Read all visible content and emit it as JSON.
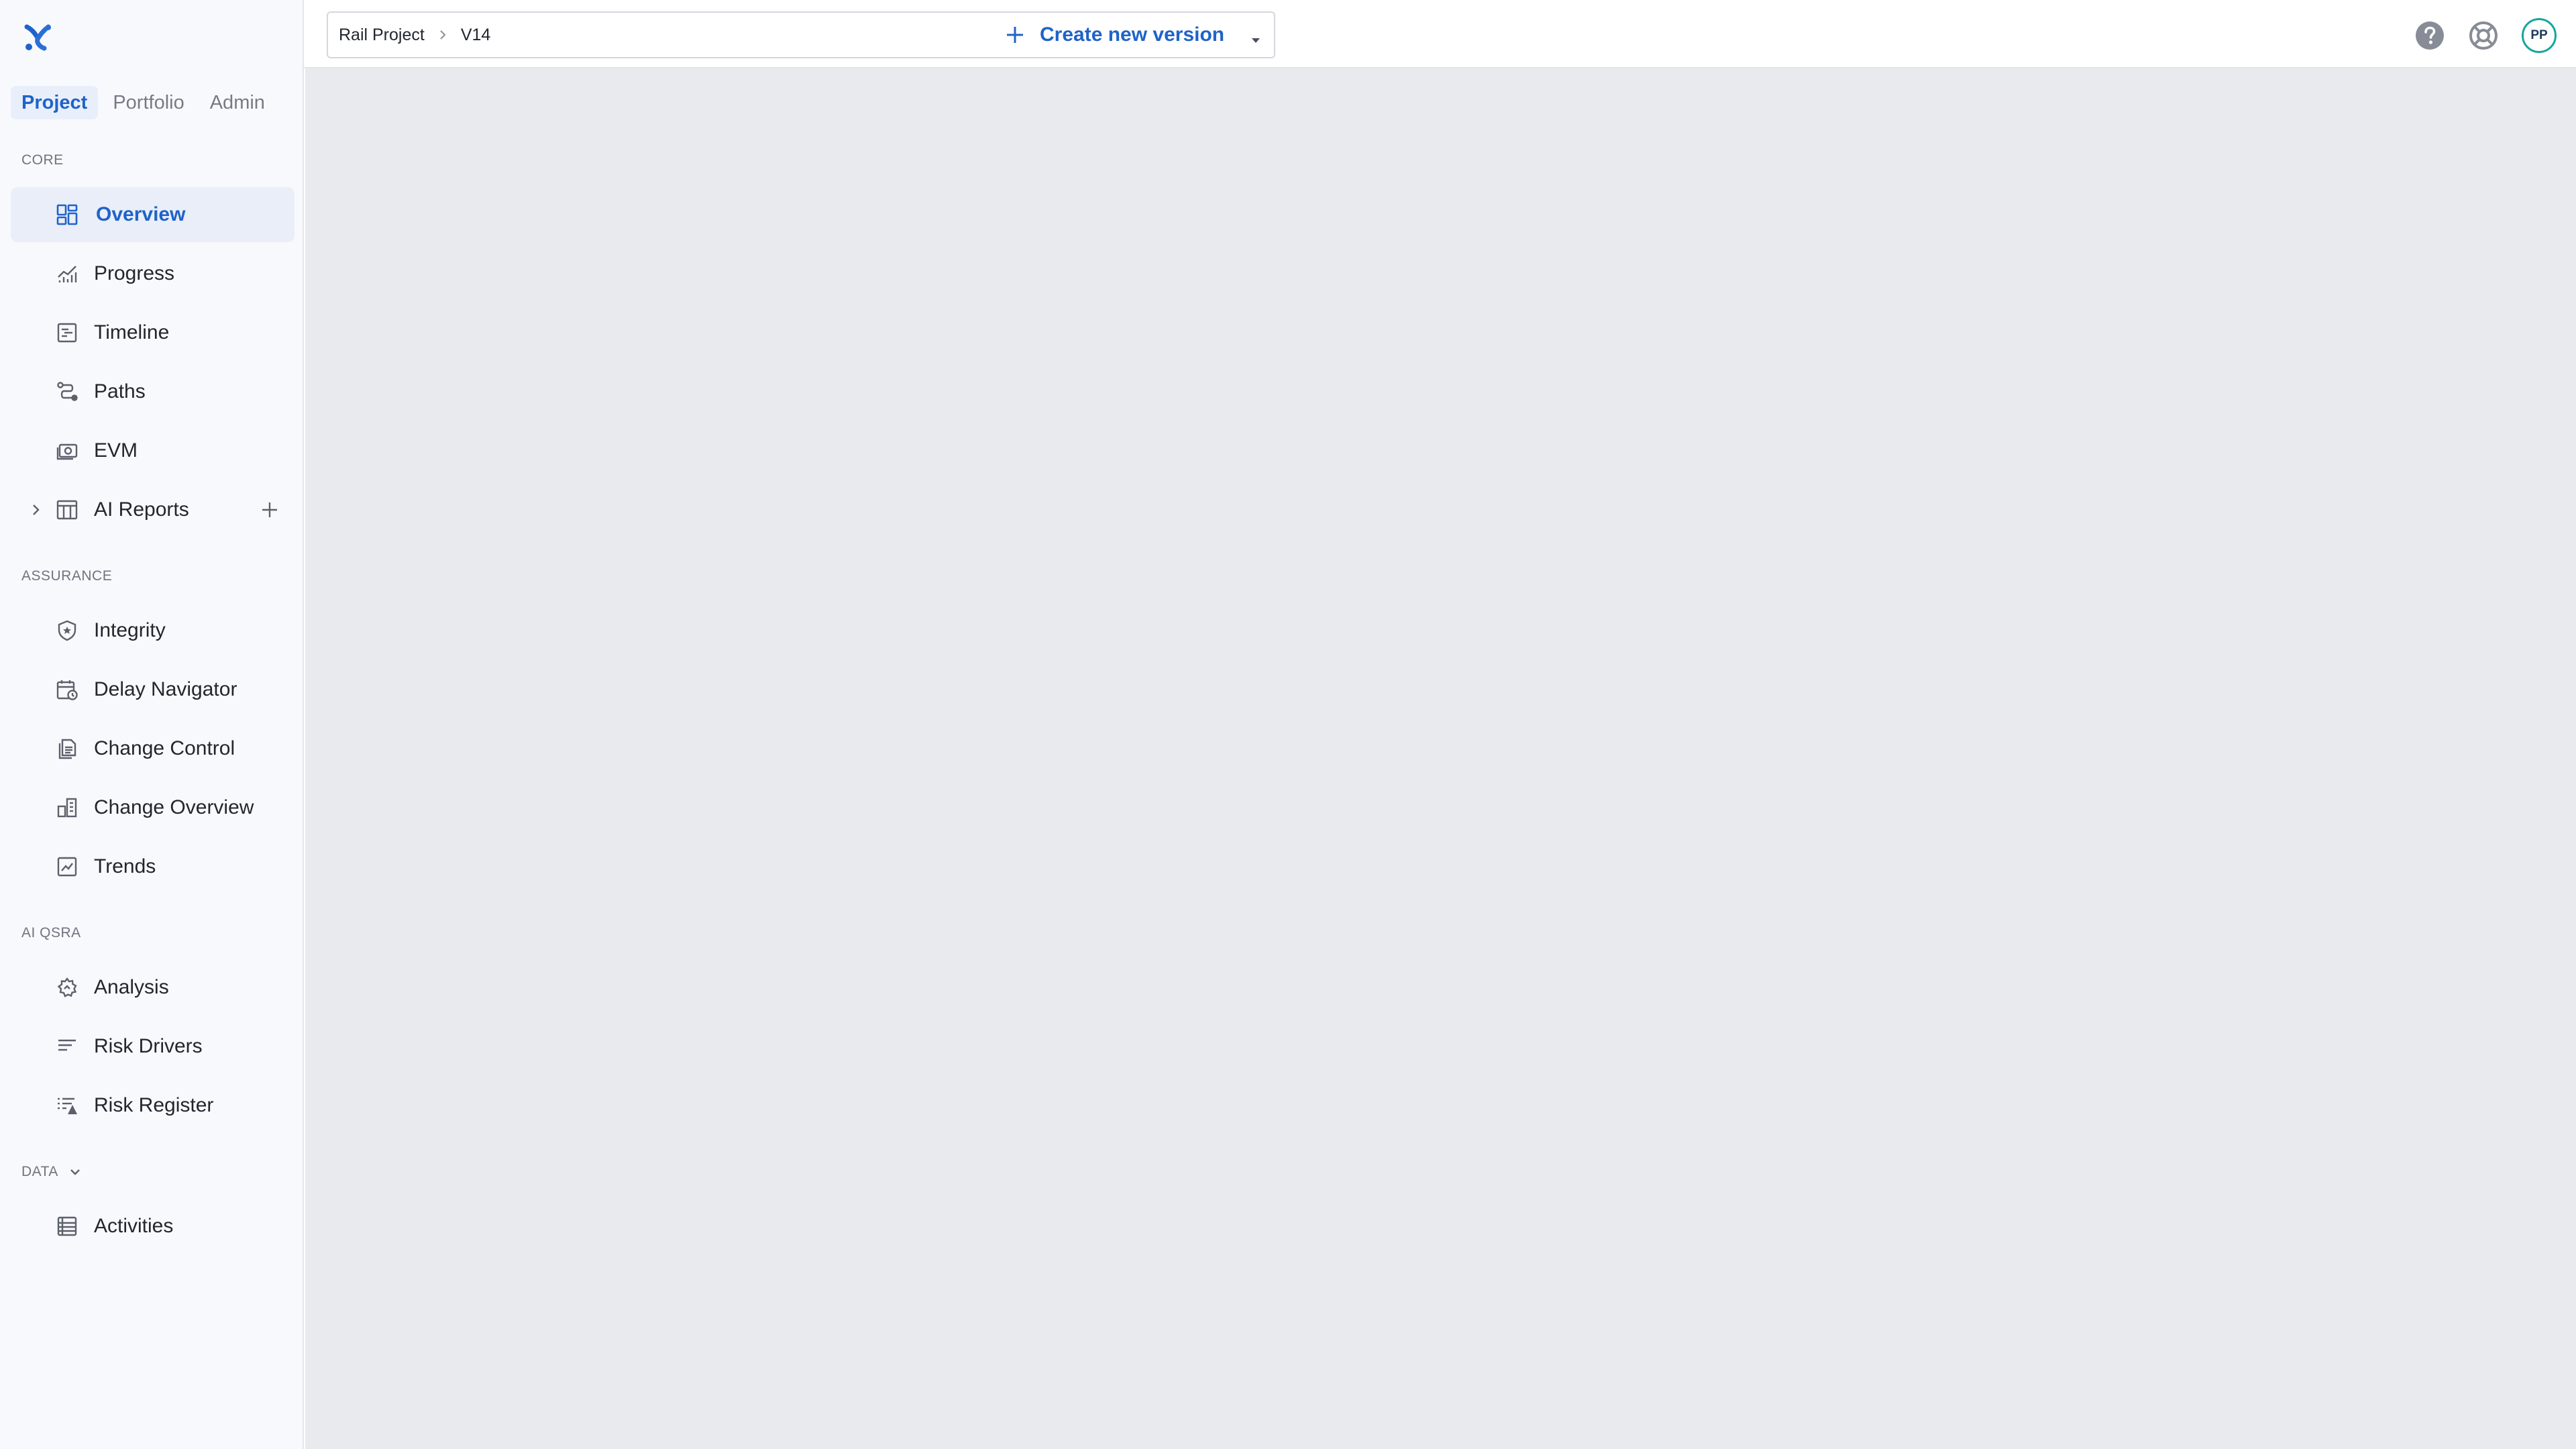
{
  "sidebar": {
    "tabs": [
      {
        "label": "Project",
        "active": true
      },
      {
        "label": "Portfolio",
        "active": false
      },
      {
        "label": "Admin",
        "active": false
      }
    ],
    "sections": {
      "core": {
        "label": "CORE",
        "items": [
          {
            "label": "Overview",
            "icon": "dashboard-icon",
            "active": true
          },
          {
            "label": "Progress",
            "icon": "progress-chart-icon"
          },
          {
            "label": "Timeline",
            "icon": "timeline-icon"
          },
          {
            "label": "Paths",
            "icon": "paths-icon"
          },
          {
            "label": "EVM",
            "icon": "money-icon"
          },
          {
            "label": "AI Reports",
            "icon": "table-icon",
            "expandable": true
          }
        ]
      },
      "assurance": {
        "label": "ASSURANCE",
        "items": [
          {
            "label": "Integrity",
            "icon": "shield-icon"
          },
          {
            "label": "Delay Navigator",
            "icon": "calendar-clock-icon"
          },
          {
            "label": "Change Control",
            "icon": "documents-icon"
          },
          {
            "label": "Change Overview",
            "icon": "buildings-icon"
          },
          {
            "label": "Trends",
            "icon": "trend-icon"
          }
        ]
      },
      "ai_qsra": {
        "label": "AI QSRA",
        "items": [
          {
            "label": "Analysis",
            "icon": "analysis-icon"
          },
          {
            "label": "Risk Drivers",
            "icon": "bars-icon"
          },
          {
            "label": "Risk Register",
            "icon": "list-warning-icon"
          }
        ]
      },
      "data": {
        "label": "DATA",
        "items": [
          {
            "label": "Activities",
            "icon": "activities-table-icon"
          }
        ]
      }
    }
  },
  "topbar": {
    "breadcrumb": {
      "project": "Rail Project",
      "version": "V14"
    },
    "create_label": "Create new version",
    "avatar_initials": "PP"
  },
  "colors": {
    "accent": "#1f63c9",
    "avatar_ring": "#14a79b",
    "content_bg": "#e9eaed",
    "sidebar_bg": "#f8f9fc"
  }
}
